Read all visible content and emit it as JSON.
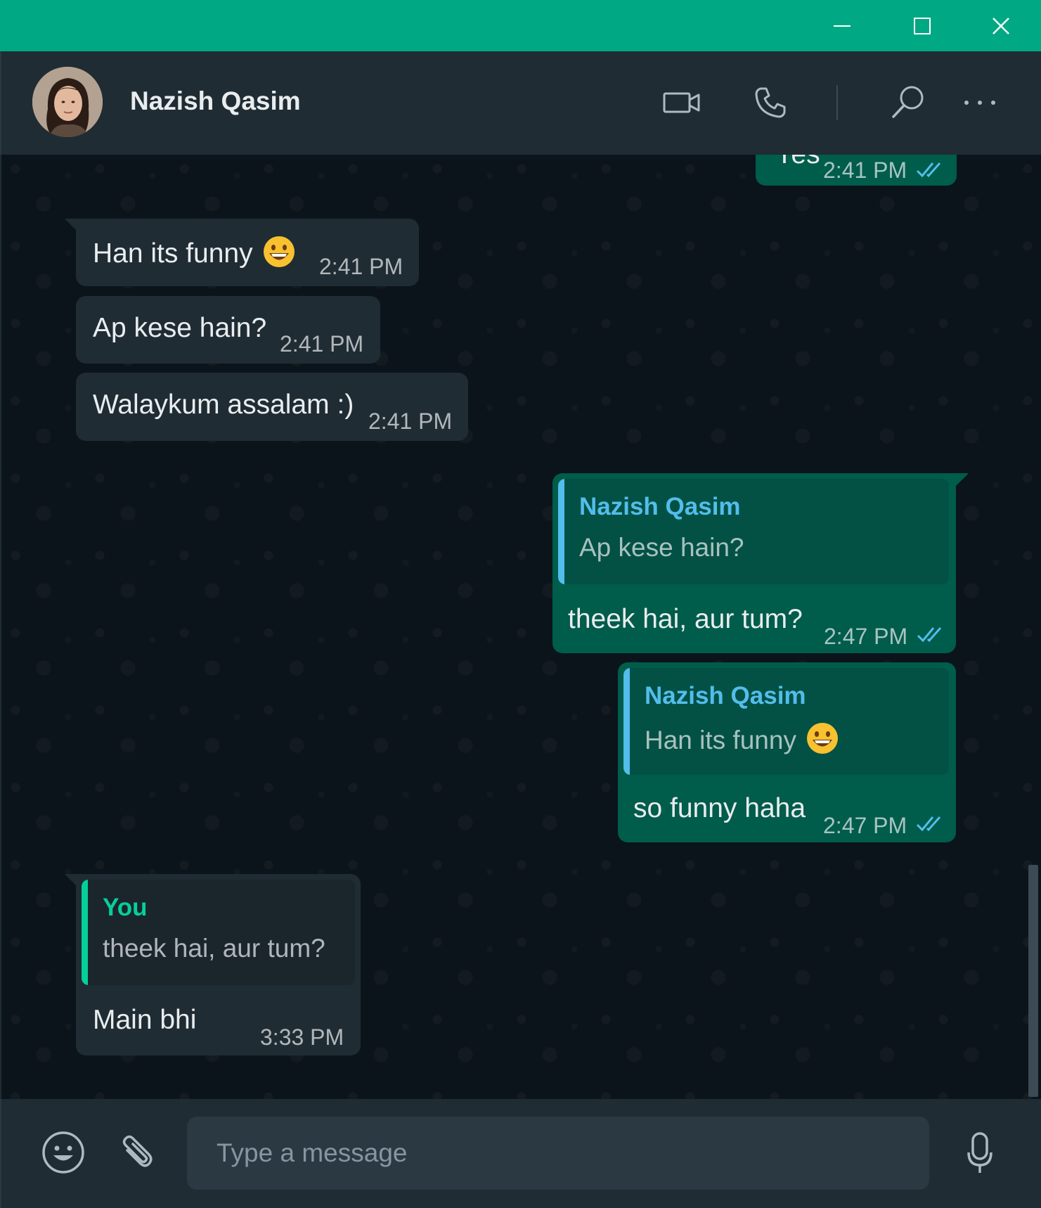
{
  "window": {
    "controls": {
      "minimize_icon": "minimize-icon",
      "maximize_icon": "maximize-icon",
      "close_icon": "close-icon"
    }
  },
  "header": {
    "contact_name": "Nazish Qasim",
    "icons": [
      "video-call-icon",
      "voice-call-icon",
      "search-icon",
      "more-options-icon"
    ]
  },
  "messages": [
    {
      "direction": "out",
      "text": "Yes",
      "time": "2:41 PM",
      "status": "read"
    },
    {
      "direction": "in",
      "text": "Han its funny",
      "emoji": "grinning-face",
      "time": "2:41 PM"
    },
    {
      "direction": "in",
      "text": "Ap kese hain?",
      "time": "2:41 PM"
    },
    {
      "direction": "in",
      "text": "Walaykum assalam :)",
      "time": "2:41 PM"
    },
    {
      "direction": "out",
      "quote_name": "Nazish Qasim",
      "quote_text": "Ap kese hain?",
      "text": "theek hai, aur tum?",
      "time": "2:47 PM",
      "status": "read"
    },
    {
      "direction": "out",
      "quote_name": "Nazish Qasim",
      "quote_text": "Han its funny",
      "quote_emoji": "grinning-face",
      "text": "so funny haha",
      "time": "2:47 PM",
      "status": "read"
    },
    {
      "direction": "in",
      "quote_name": "You",
      "quote_text": "theek hai, aur tum?",
      "text": "Main bhi",
      "time": "3:33 PM"
    }
  ],
  "composer": {
    "placeholder": "Type a message",
    "value": "",
    "icons": [
      "emoji-icon",
      "attach-icon",
      "microphone-icon"
    ]
  },
  "colors": {
    "title_bar": "#00a884",
    "header_bg": "#202c33",
    "chat_bg": "#0b141a",
    "incoming_bubble": "#202c33",
    "outgoing_bubble": "#005c4b",
    "quote_name_contact": "#53bdeb",
    "quote_name_you": "#06cf9c",
    "read_ticks": "#53bdeb"
  }
}
